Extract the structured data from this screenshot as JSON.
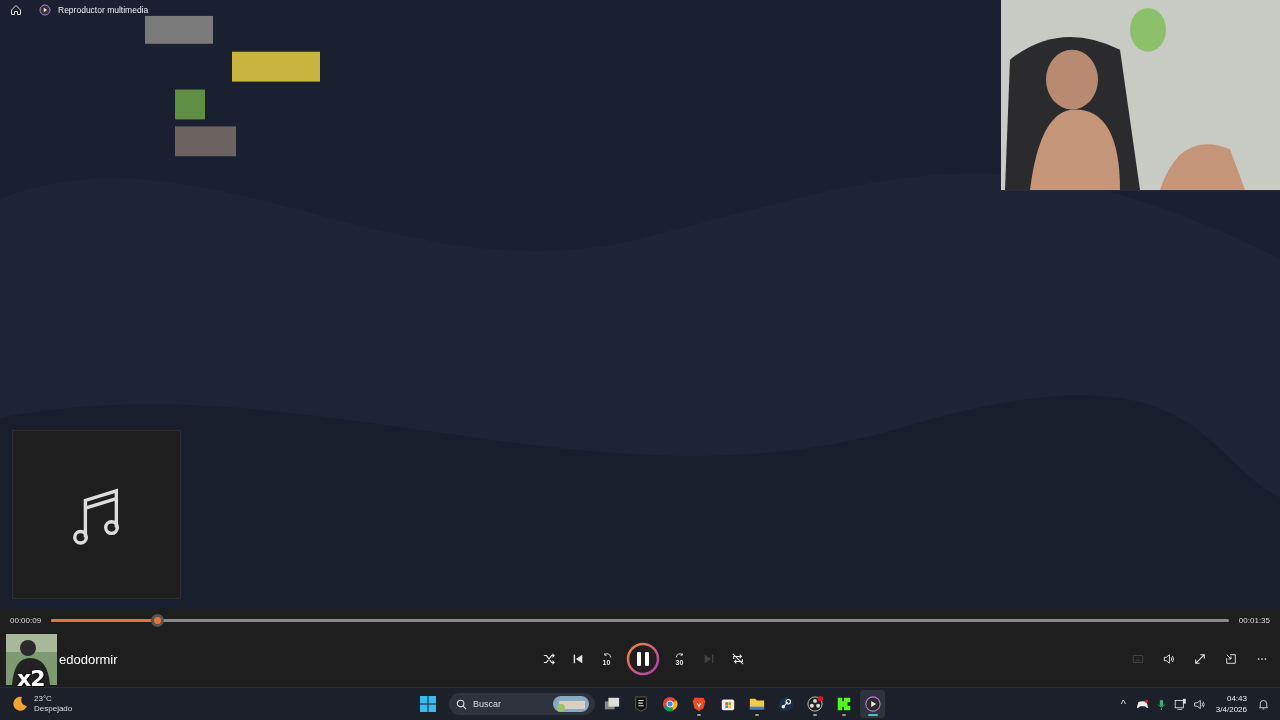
{
  "player": {
    "title": "Reproductor multimedia"
  },
  "seek": {
    "elapsed": "00:00:09",
    "total": "00:01:35",
    "level": 0.09
  },
  "now_playing": {
    "title": "edodormir",
    "badge": "x2"
  },
  "controls": [
    {
      "kind": "shuffle",
      "disabled": false
    },
    {
      "kind": "previous",
      "disabled": false
    },
    {
      "kind": "rewind",
      "label": "10",
      "disabled": false
    },
    {
      "kind": "pause",
      "disabled": false
    },
    {
      "kind": "forward",
      "label": "30",
      "disabled": false
    },
    {
      "kind": "next",
      "disabled": true
    },
    {
      "kind": "repeat",
      "disabled": false
    }
  ],
  "options": [
    {
      "kind": "captions",
      "disabled": true
    },
    {
      "kind": "volume",
      "disabled": false
    },
    {
      "kind": "fullscreen",
      "disabled": false
    },
    {
      "kind": "miniplayer",
      "disabled": false
    },
    {
      "kind": "more",
      "disabled": false
    }
  ],
  "taskbar": {
    "weather": {
      "temperature": "23°C",
      "condition": "Despejado"
    },
    "search": {
      "placeholder": "Buscar"
    },
    "apps": [
      {
        "kind": "task-view",
        "running": false,
        "selected": false
      },
      {
        "kind": "epic",
        "running": false,
        "selected": false
      },
      {
        "kind": "chrome",
        "running": false,
        "selected": false
      },
      {
        "kind": "brave",
        "running": true,
        "selected": false
      },
      {
        "kind": "store",
        "running": false,
        "selected": false
      },
      {
        "kind": "folder",
        "running": true,
        "selected": false
      },
      {
        "kind": "steam",
        "running": false,
        "selected": false
      },
      {
        "kind": "obs",
        "running": true,
        "selected": false
      },
      {
        "kind": "kick",
        "running": true,
        "selected": false
      },
      {
        "kind": "player",
        "running": true,
        "selected": true
      }
    ],
    "tray": {
      "overflow": "^",
      "time": "04:43",
      "date": "3/4/2026"
    }
  }
}
